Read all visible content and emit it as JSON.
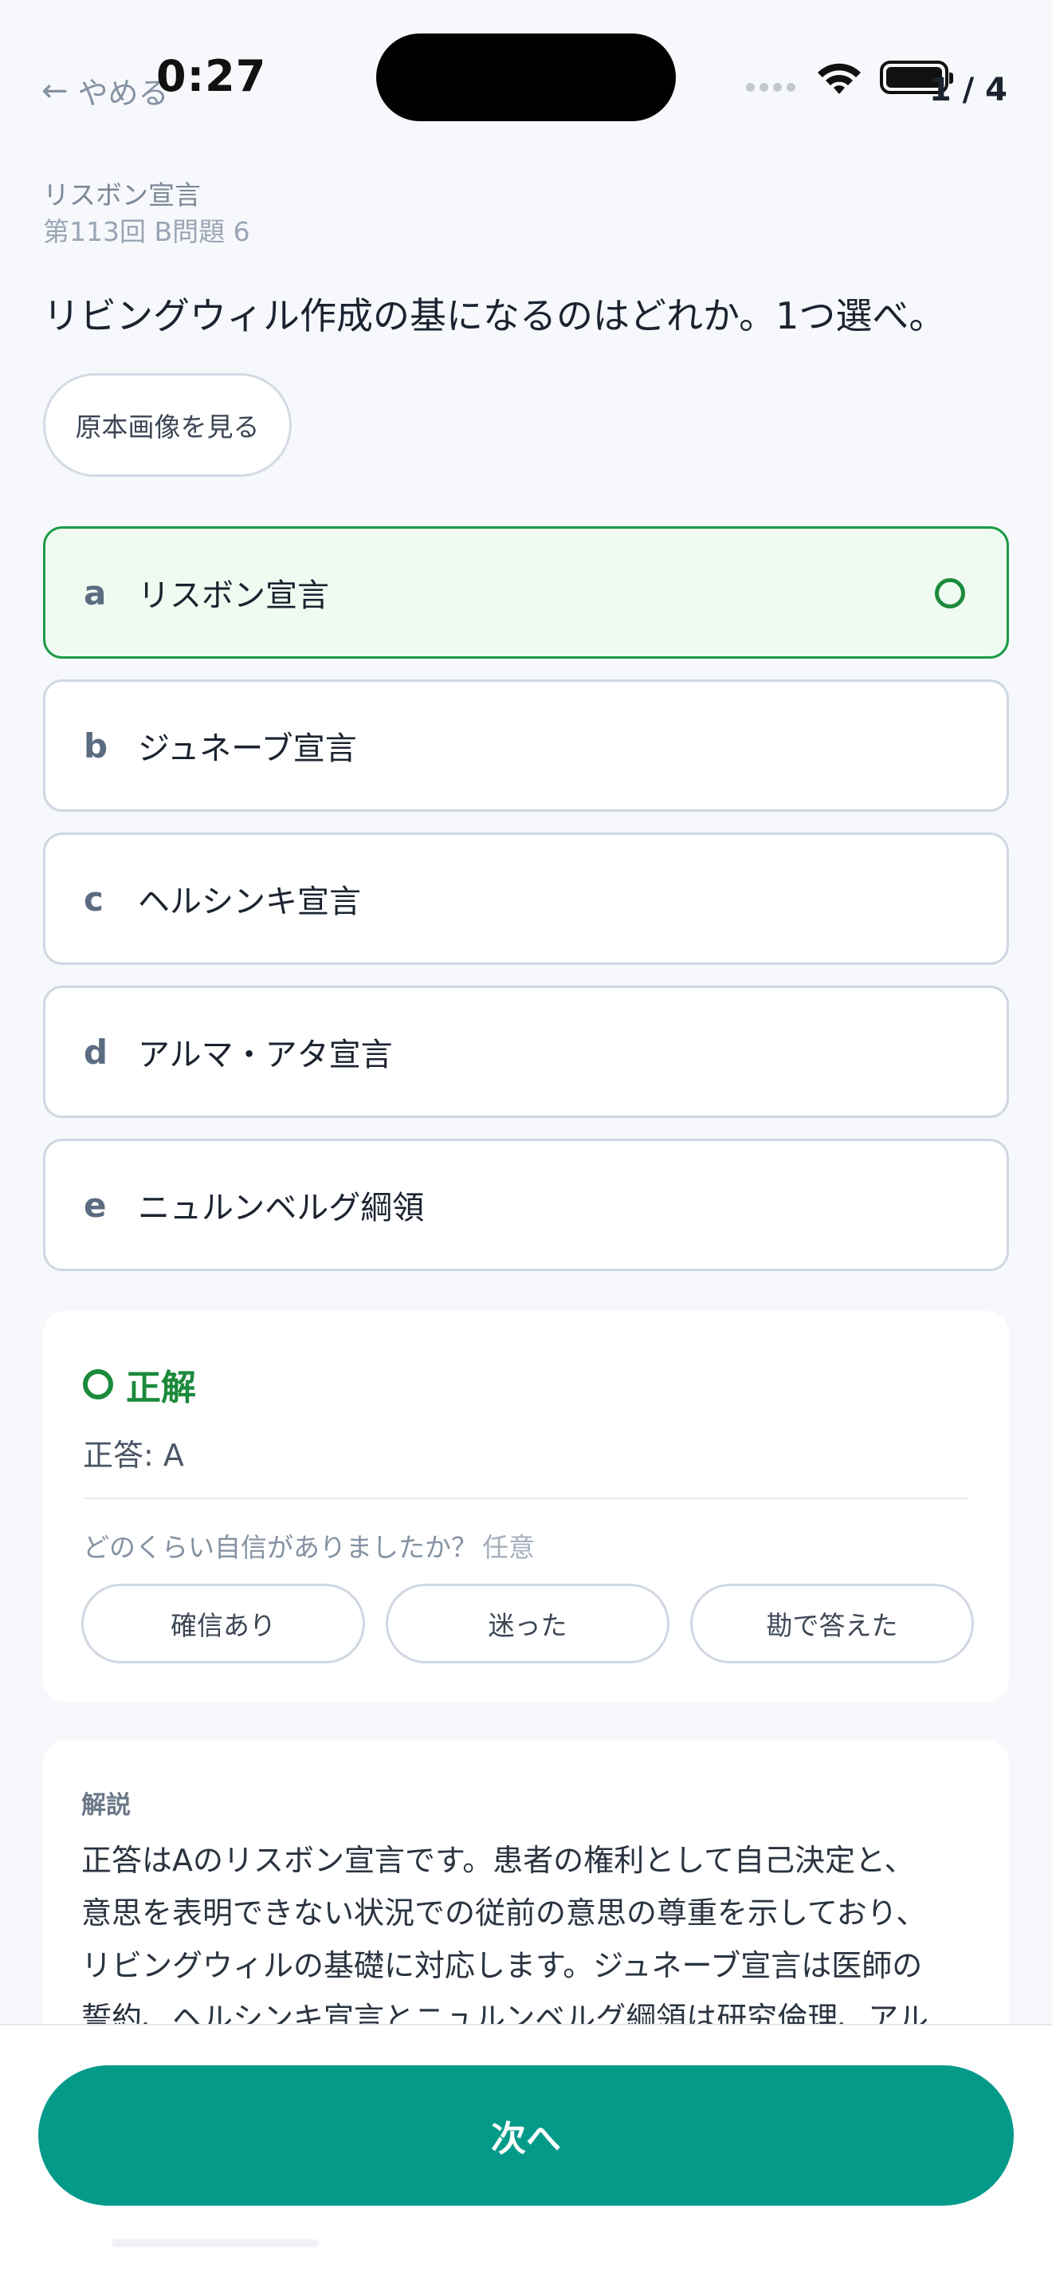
{
  "status_bar": {
    "time": "0:27",
    "quit_label": "やめる",
    "progress": "1 / 4"
  },
  "question": {
    "topic": "リスボン宣言",
    "exam_number": "第113回 B問題 6",
    "text": "リビングウィル作成の基になるのはどれか。1つ選べ。",
    "original_image_button": "原本画像を見る"
  },
  "choices": [
    {
      "letter": "a",
      "text": "リスボン宣言",
      "state": "correct"
    },
    {
      "letter": "b",
      "text": "ジュネーブ宣言",
      "state": "default"
    },
    {
      "letter": "c",
      "text": "ヘルシンキ宣言",
      "state": "default"
    },
    {
      "letter": "d",
      "text": "アルマ・アタ宣言",
      "state": "default"
    },
    {
      "letter": "e",
      "text": "ニュルンベルグ綱領",
      "state": "default"
    }
  ],
  "result": {
    "label": "正解",
    "answer": "正答: A",
    "confidence_prompt": "どのくらい自信がありましたか？",
    "optional_label": "任意",
    "options": [
      "確信あり",
      "迷った",
      "勘で答えた"
    ]
  },
  "explanation": {
    "title": "解説",
    "lines": [
      "正答はAのリスボン宣言です。患者の権利として自己決定と、",
      "意思を表明できない状況での従前の意思の尊重を示しており、",
      "リビングウィルの基礎に対応します。ジュネーブ宣言は医師の",
      "誓約、ヘルシンキ宣言とニュルンベルグ綱領は研究倫理、アル"
    ]
  },
  "footer": {
    "next_label": "次へ"
  },
  "colors": {
    "correct": "#1c8a3c",
    "primary": "#049a8a",
    "correct_bg": "#effbf1"
  }
}
